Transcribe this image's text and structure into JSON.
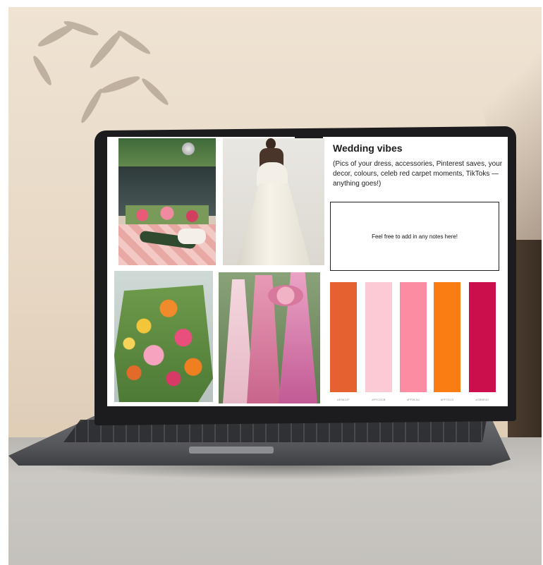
{
  "board": {
    "title": "Wedding vibes",
    "description": "(Pics of your dress, accessories, Pinterest saves, your decor, colours, celeb red carpet moments, TikToks — anything goes!)",
    "notes_placeholder": "Feel free to add in any notes here!"
  },
  "palette": [
    {
      "color": "#e5612f",
      "label": "#E5612F"
    },
    {
      "color": "#fccad5",
      "label": "#FFC0CB"
    },
    {
      "color": "#fb8ca1",
      "label": "#FF8CA1"
    },
    {
      "color": "#fa7d13",
      "label": "#FF7D13"
    },
    {
      "color": "#cb0e4c",
      "label": "#CB0E4C"
    }
  ],
  "photos": [
    {
      "name": "floral-reception-photo"
    },
    {
      "name": "white-gown-photo"
    },
    {
      "name": "flower-arrangement-photo"
    },
    {
      "name": "pink-gowns-photo"
    }
  ]
}
